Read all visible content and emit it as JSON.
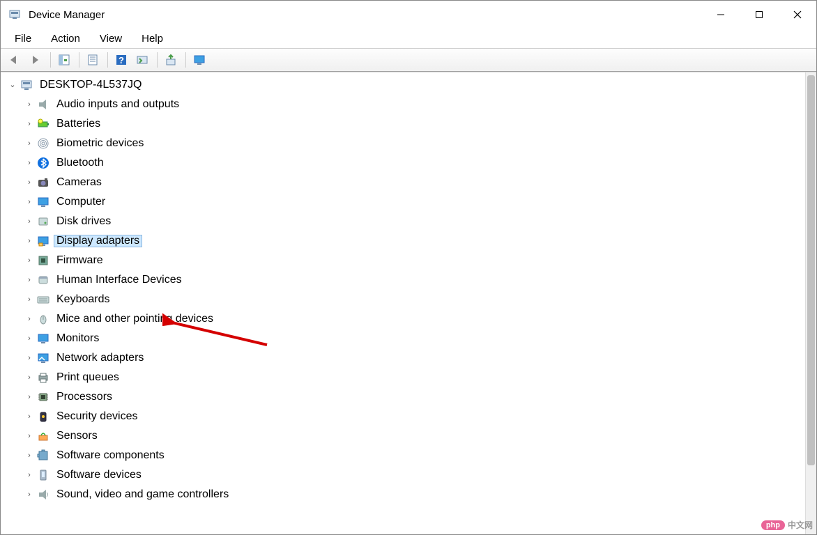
{
  "window": {
    "title": "Device Manager"
  },
  "menu": {
    "file": "File",
    "action": "Action",
    "view": "View",
    "help": "Help"
  },
  "toolbar": {
    "back": "back",
    "forward": "forward",
    "show_hidden": "show-hidden",
    "properties": "properties",
    "help": "help",
    "refresh": "refresh",
    "update_driver": "update-driver",
    "monitor": "monitor"
  },
  "tree": {
    "root": "DESKTOP-4L537JQ",
    "items": [
      {
        "label": "Audio inputs and outputs",
        "icon": "speaker"
      },
      {
        "label": "Batteries",
        "icon": "battery"
      },
      {
        "label": "Biometric devices",
        "icon": "fingerprint"
      },
      {
        "label": "Bluetooth",
        "icon": "bluetooth"
      },
      {
        "label": "Cameras",
        "icon": "camera"
      },
      {
        "label": "Computer",
        "icon": "computer"
      },
      {
        "label": "Disk drives",
        "icon": "disk"
      },
      {
        "label": "Display adapters",
        "icon": "display",
        "selected": true
      },
      {
        "label": "Firmware",
        "icon": "firmware"
      },
      {
        "label": "Human Interface Devices",
        "icon": "hid"
      },
      {
        "label": "Keyboards",
        "icon": "keyboard"
      },
      {
        "label": "Mice and other pointing devices",
        "icon": "mouse"
      },
      {
        "label": "Monitors",
        "icon": "monitor"
      },
      {
        "label": "Network adapters",
        "icon": "network"
      },
      {
        "label": "Print queues",
        "icon": "printer"
      },
      {
        "label": "Processors",
        "icon": "cpu"
      },
      {
        "label": "Security devices",
        "icon": "security"
      },
      {
        "label": "Sensors",
        "icon": "sensor"
      },
      {
        "label": "Software components",
        "icon": "software-comp"
      },
      {
        "label": "Software devices",
        "icon": "software-dev"
      },
      {
        "label": "Sound, video and game controllers",
        "icon": "sound"
      }
    ]
  },
  "watermark": {
    "pill": "php",
    "text": "中文网"
  }
}
